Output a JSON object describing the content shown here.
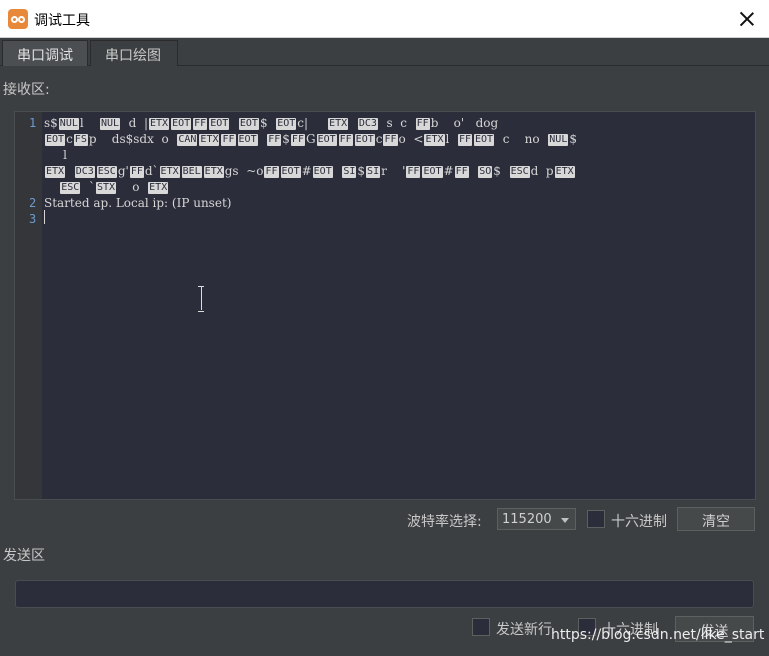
{
  "window": {
    "title": "调试工具"
  },
  "tabs": [
    {
      "label": "串口调试",
      "active": true
    },
    {
      "label": "串口绘图",
      "active": false
    }
  ],
  "receive": {
    "label": "接收区:",
    "line_numbers": [
      "1",
      "2",
      "3"
    ],
    "lines": [
      "s$NULl   NUL d  ETXEOTFFEOT  EOT$ EOTc    ETX  DC3 s c FFb  o' dog",
      "EOTcFSp   ds$sdx o CANETXFFEOT FF$FFGEOTFFEOTcFFo <ETXl FFEOT c  no NUL$",
      "     l",
      "ETX DC3ESCg'FFd`ETXBELETXgs  ~oFFEOT#EOT  SI$SIr  'FFEOT#FF SO$ ESCd pETX",
      "    ESC `STX   o ETX",
      "Started ap. Local ip: (IP unset)"
    ]
  },
  "controls": {
    "baud_label": "波特率选择:",
    "baud_value": "115200",
    "hex_label": "十六进制",
    "clear_label": "清空"
  },
  "send": {
    "label": "发送区",
    "newline_label": "发送新行",
    "hex_label": "十六进制",
    "send_label": "发送"
  },
  "watermark": "https://blog.csdn.net/like_start",
  "colors": {
    "background": "#3c3f41",
    "editor_bg": "#2b2d3a",
    "line_number": "#6b9bd1",
    "accent_icon": "#e8883a"
  }
}
